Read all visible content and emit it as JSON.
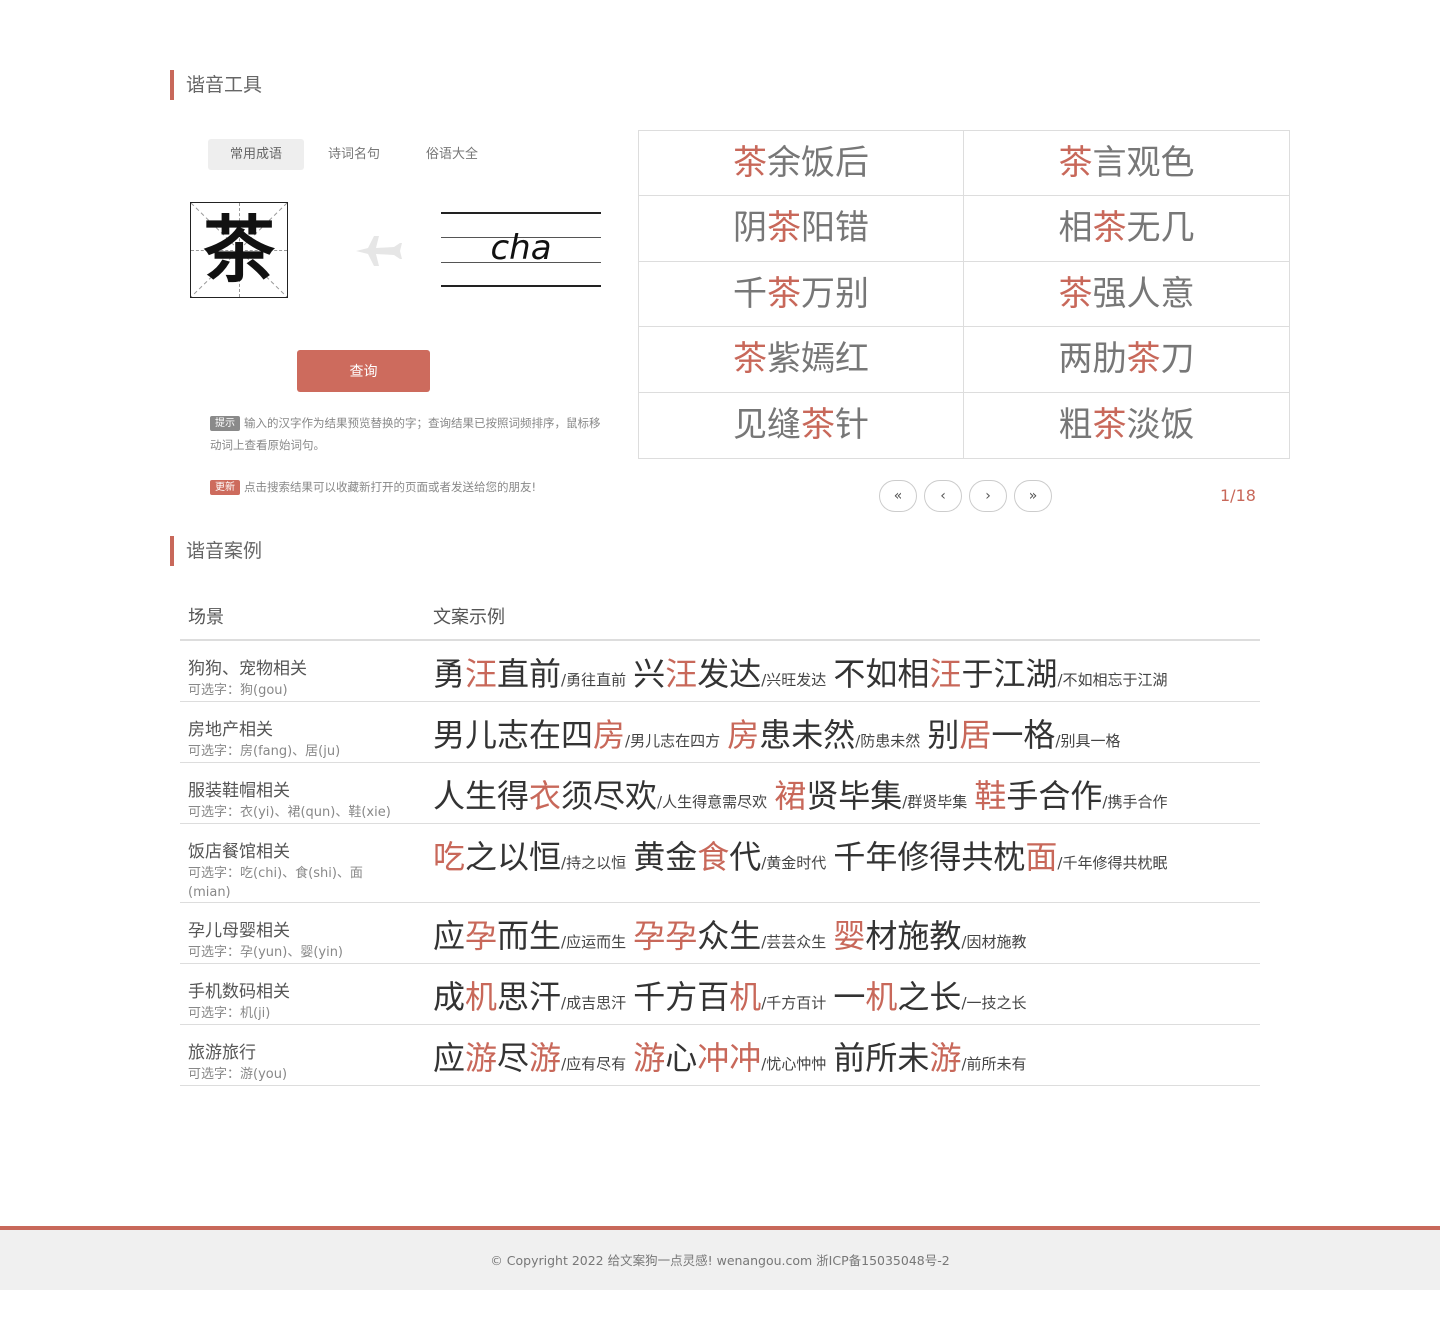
{
  "sections": {
    "tool_title": "谐音工具",
    "cases_title": "谐音案例"
  },
  "tabs": [
    {
      "label": "常用成语",
      "active": true
    },
    {
      "label": "诗词名句",
      "active": false
    },
    {
      "label": "俗语大全",
      "active": false
    }
  ],
  "input_char": "茶",
  "pinyin": "cha",
  "query_button": "查询",
  "tip": {
    "badge": "提示",
    "text": "输入的汉字作为结果预览替换的字；查询结果已按照词频排序，鼠标移动词上查看原始词句。"
  },
  "update": {
    "badge": "更新",
    "text": "点击搜索结果可以收藏新打开的页面或者发送给您的朋友!"
  },
  "results": [
    {
      "pre": "",
      "hl": "茶",
      "post": "余饭后"
    },
    {
      "pre": "",
      "hl": "茶",
      "post": "言观色"
    },
    {
      "pre": "阴",
      "hl": "茶",
      "post": "阳错"
    },
    {
      "pre": "相",
      "hl": "茶",
      "post": "无几"
    },
    {
      "pre": "千",
      "hl": "茶",
      "post": "万别"
    },
    {
      "pre": "",
      "hl": "茶",
      "post": "强人意"
    },
    {
      "pre": "",
      "hl": "茶",
      "post": "紫嫣红"
    },
    {
      "pre": "两肋",
      "hl": "茶",
      "post": "刀"
    },
    {
      "pre": "见缝",
      "hl": "茶",
      "post": "针"
    },
    {
      "pre": "粗",
      "hl": "茶",
      "post": "淡饭"
    }
  ],
  "pager": {
    "first": "«",
    "prev": "‹",
    "next": "›",
    "last": "»",
    "info": "1/18"
  },
  "cases": {
    "col_scene": "场景",
    "col_example": "文案示例",
    "rows": [
      {
        "scene": "狗狗、宠物相关",
        "options": "可选字：狗(gou)",
        "examples": [
          {
            "parts": [
              [
                "勇",
                0
              ],
              [
                "汪",
                1
              ],
              [
                "直前",
                0
              ]
            ],
            "orig": "/勇往直前"
          },
          {
            "parts": [
              [
                "兴",
                0
              ],
              [
                "汪",
                1
              ],
              [
                "发达",
                0
              ]
            ],
            "orig": "/兴旺发达"
          },
          {
            "parts": [
              [
                "不如相",
                0
              ],
              [
                "汪",
                1
              ],
              [
                "于江湖",
                0
              ]
            ],
            "orig": "/不如相忘于江湖"
          }
        ]
      },
      {
        "scene": "房地产相关",
        "options": "可选字：房(fang)、居(ju)",
        "examples": [
          {
            "parts": [
              [
                "男儿志在四",
                0
              ],
              [
                "房",
                1
              ]
            ],
            "orig": "/男儿志在四方"
          },
          {
            "parts": [
              [
                "房",
                1
              ],
              [
                "患未然",
                0
              ]
            ],
            "orig": "/防患未然"
          },
          {
            "parts": [
              [
                "别",
                0
              ],
              [
                "居",
                1
              ],
              [
                "一格",
                0
              ]
            ],
            "orig": "/别具一格"
          }
        ]
      },
      {
        "scene": "服装鞋帽相关",
        "options": "可选字：衣(yi)、裙(qun)、鞋(xie)",
        "examples": [
          {
            "parts": [
              [
                "人生得",
                0
              ],
              [
                "衣",
                1
              ],
              [
                "须尽欢",
                0
              ]
            ],
            "orig": "/人生得意需尽欢"
          },
          {
            "parts": [
              [
                "裙",
                1
              ],
              [
                "贤毕集",
                0
              ]
            ],
            "orig": "/群贤毕集"
          },
          {
            "parts": [
              [
                "鞋",
                1
              ],
              [
                "手合作",
                0
              ]
            ],
            "orig": "/携手合作"
          }
        ]
      },
      {
        "scene": "饭店餐馆相关",
        "options": "可选字：吃(chi)、食(shi)、面(mian)",
        "examples": [
          {
            "parts": [
              [
                "吃",
                1
              ],
              [
                "之以恒",
                0
              ]
            ],
            "orig": "/持之以恒"
          },
          {
            "parts": [
              [
                "黄金",
                0
              ],
              [
                "食",
                1
              ],
              [
                "代",
                0
              ]
            ],
            "orig": "/黄金时代"
          },
          {
            "parts": [
              [
                "千年修得共枕",
                0
              ],
              [
                "面",
                1
              ]
            ],
            "orig": "/千年修得共枕眠"
          }
        ]
      },
      {
        "scene": "孕儿母婴相关",
        "options": "可选字：孕(yun)、婴(yin)",
        "examples": [
          {
            "parts": [
              [
                "应",
                0
              ],
              [
                "孕",
                1
              ],
              [
                "而生",
                0
              ]
            ],
            "orig": "/应运而生"
          },
          {
            "parts": [
              [
                "孕孕",
                1
              ],
              [
                "众生",
                0
              ]
            ],
            "orig": "/芸芸众生"
          },
          {
            "parts": [
              [
                "婴",
                1
              ],
              [
                "材施教",
                0
              ]
            ],
            "orig": "/因材施教"
          }
        ]
      },
      {
        "scene": "手机数码相关",
        "options": "可选字：机(ji)",
        "examples": [
          {
            "parts": [
              [
                "成",
                0
              ],
              [
                "机",
                1
              ],
              [
                "思汗",
                0
              ]
            ],
            "orig": "/成吉思汗"
          },
          {
            "parts": [
              [
                "千方百",
                0
              ],
              [
                "机",
                1
              ]
            ],
            "orig": "/千方百计"
          },
          {
            "parts": [
              [
                "一",
                0
              ],
              [
                "机",
                1
              ],
              [
                "之长",
                0
              ]
            ],
            "orig": "/一技之长"
          }
        ]
      },
      {
        "scene": "旅游旅行",
        "options": "可选字：游(you)",
        "examples": [
          {
            "parts": [
              [
                "应",
                0
              ],
              [
                "游",
                1
              ],
              [
                "尽",
                0
              ],
              [
                "游",
                1
              ]
            ],
            "orig": "/应有尽有"
          },
          {
            "parts": [
              [
                "游",
                1
              ],
              [
                "心",
                0
              ],
              [
                "冲冲",
                1
              ]
            ],
            "orig": "/忧心忡忡"
          },
          {
            "parts": [
              [
                "前所未",
                0
              ],
              [
                "游",
                1
              ]
            ],
            "orig": "/前所未有"
          }
        ]
      }
    ]
  },
  "footer": "© Copyright 2022 给文案狗一点灵感! wenangou.com 浙ICP备15035048号-2",
  "colors": {
    "accent": "#c8685a"
  }
}
